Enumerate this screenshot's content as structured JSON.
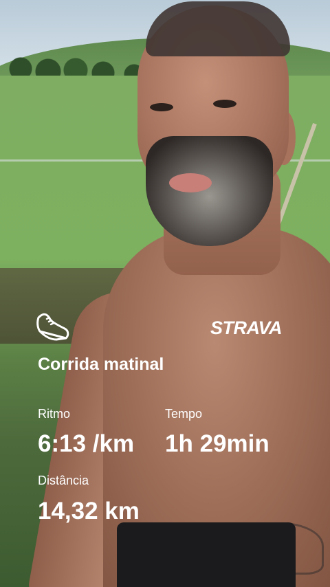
{
  "brand": "STRAVA",
  "activity": {
    "title": "Corrida matinal",
    "icon": "running-shoe-icon"
  },
  "stats": {
    "pace_label": "Ritmo",
    "pace_value": "6:13 /km",
    "time_label": "Tempo",
    "time_value": "1h 29min",
    "distance_label": "Distância",
    "distance_value": "14,32 km"
  },
  "colors": {
    "text": "#ffffff"
  }
}
